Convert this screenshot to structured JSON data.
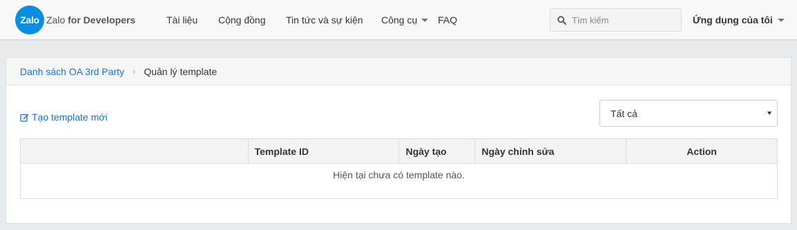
{
  "header": {
    "logo_badge": "Zalo",
    "logo_text": "Zalo",
    "logo_text_bold": "for Developers",
    "nav": [
      {
        "label": "Tài liệu"
      },
      {
        "label": "Cộng đồng"
      },
      {
        "label": "Tin tức và sự kiện"
      },
      {
        "label": "Công cụ"
      },
      {
        "label": "FAQ"
      }
    ],
    "search_placeholder": "Tìm kiếm",
    "my_apps_label": "Ứng dụng của tôi"
  },
  "breadcrumb": {
    "parent": "Danh sách OA 3rd Party",
    "current": "Quản lý template"
  },
  "toolbar": {
    "create_label": "Tạo template mới",
    "filter_selected": "Tất cả"
  },
  "table": {
    "columns": [
      "",
      "Template ID",
      "Ngày tạo",
      "Ngày chỉnh sửa",
      "Action"
    ],
    "empty_message": "Hiện tại chưa có template nào."
  },
  "colors": {
    "brand": "#0a8ee0",
    "link": "#1a73c8",
    "page_bg": "#e9eaec"
  }
}
